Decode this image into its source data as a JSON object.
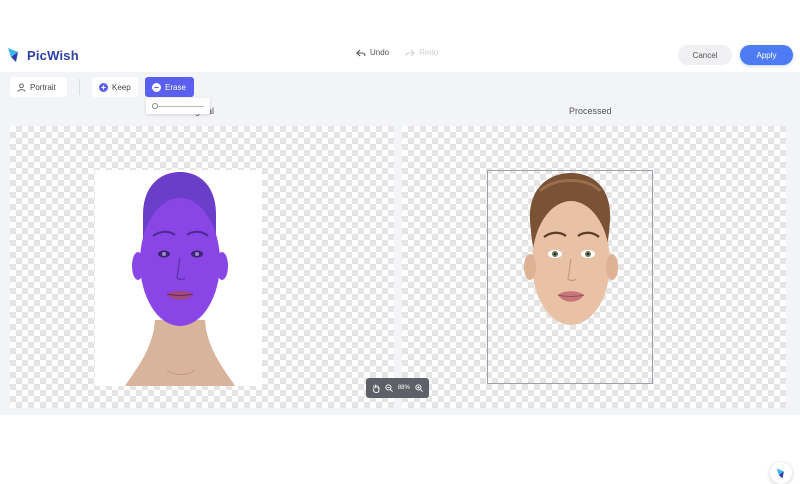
{
  "app": {
    "name": "PicWish"
  },
  "header": {
    "undo_label": "Undo",
    "redo_label": "Redo",
    "cancel_label": "Cancel",
    "apply_label": "Apply"
  },
  "toolbar": {
    "portrait_label": "Portrait",
    "keep_label": "Keep",
    "erase_label": "Erase",
    "active_tool": "Erase"
  },
  "panels": {
    "original_label": "Original",
    "processed_label": "Processed"
  },
  "zoom": {
    "level": "88%"
  },
  "icons": {
    "logo": "picwish-logo-icon",
    "undo": "undo-arrow-icon",
    "redo": "redo-arrow-icon",
    "portrait": "person-icon",
    "keep": "plus-circle-icon",
    "erase": "minus-circle-icon",
    "hand": "hand-pan-icon",
    "zoom_out": "zoom-out-icon",
    "zoom_in": "zoom-in-icon"
  },
  "colors": {
    "accent": "#5b5ff0",
    "apply": "#4d7bf3",
    "brand_text": "#2d3fa8",
    "erase_overlay": "#8a45e6"
  }
}
